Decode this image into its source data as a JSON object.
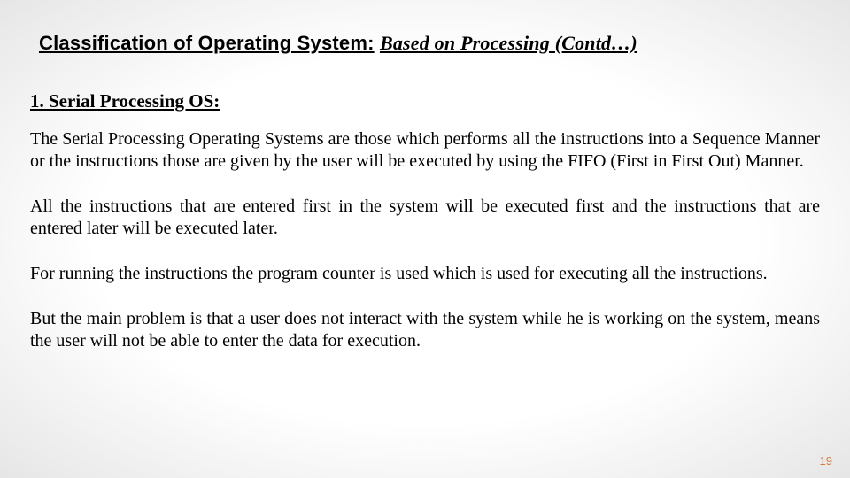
{
  "title": {
    "main": "Classification of Operating System:",
    "sub": "Based on Processing (Contd…)"
  },
  "subheading": "1. Serial Processing OS:",
  "paragraphs": {
    "p1": "The Serial Processing Operating Systems are those which performs all the instructions into a Sequence Manner or the instructions those are given by the user will be executed by using the FIFO (First in First Out) Manner.",
    "p2": "All the instructions that are entered first in the system will be executed first and the instructions that are entered later will be executed later.",
    "p3": "For running the instructions the program counter is used which is used for executing all the instructions.",
    "p4": "But the main problem is that a user does not interact with the system while he is working on the system, means the user will not be able to enter the data for execution."
  },
  "page_number": "19"
}
